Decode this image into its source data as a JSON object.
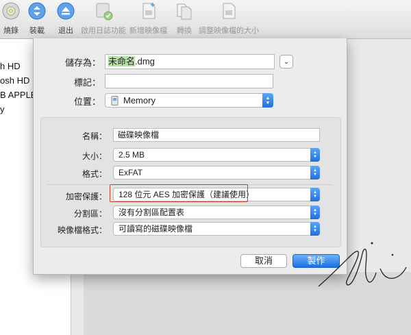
{
  "toolbar": {
    "items": [
      {
        "label": "燒錄",
        "icon": "burn-disc-icon"
      },
      {
        "label": "裝載",
        "icon": "mount-icon"
      },
      {
        "label": "退出",
        "icon": "eject-icon"
      },
      {
        "label": "啟用日誌功能",
        "icon": "enable-journaling-icon"
      },
      {
        "label": "新增映像檔",
        "icon": "new-image-icon"
      },
      {
        "label": "轉換",
        "icon": "convert-icon"
      },
      {
        "label": "調整映像檔的大小",
        "icon": "resize-image-icon"
      }
    ]
  },
  "sidebar": {
    "items": [
      "h HD",
      "osh HD",
      "B APPLE",
      "y"
    ]
  },
  "sheet": {
    "save_as_label": "儲存為：",
    "save_as_highlight": "未命名",
    "save_as_ext": ".dmg",
    "tags_label": "標記：",
    "tags_value": "",
    "location_label": "位置：",
    "location_value": "Memory",
    "name_label": "名稱：",
    "name_value": "磁碟映像檔",
    "size_label": "大小：",
    "size_value": "2.5 MB",
    "format_label": "格式：",
    "format_value": "ExFAT",
    "encryption_label": "加密保護：",
    "encryption_value": "128 位元 AES 加密保護（建議使用）",
    "partitions_label": "分割區：",
    "partitions_value": "沒有分割區配置表",
    "image_format_label": "映像檔格式：",
    "image_format_value": "可讀寫的磁碟映像檔",
    "cancel_label": "取消",
    "create_label": "製作"
  },
  "colors": {
    "accent": "#1d6fe3",
    "highlight": "#b9e3a6",
    "annotation": "#c8412a"
  }
}
